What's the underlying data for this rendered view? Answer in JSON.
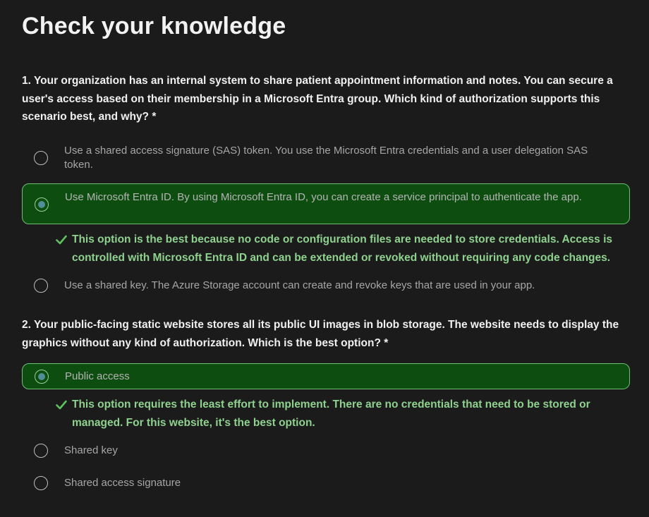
{
  "page": {
    "title": "Check your knowledge"
  },
  "questions": [
    {
      "text": "1. Your organization has an internal system to share patient appointment information and notes. You can secure a user's access based on their membership in a Microsoft Entra group. Which kind of authorization supports this scenario best, and why?",
      "required_marker": "*",
      "options": [
        {
          "label": "Use a shared access signature (SAS) token. You use the Microsoft Entra credentials and a user delegation SAS token.",
          "selected": false
        },
        {
          "label": "Use Microsoft Entra ID. By using Microsoft Entra ID, you can create a service principal to authenticate the app.",
          "selected": true
        },
        {
          "label": "Use a shared key. The Azure Storage account can create and revoke keys that are used in your app.",
          "selected": false
        }
      ],
      "feedback": "This option is the best because no code or configuration files are needed to store credentials. Access is controlled with Microsoft Entra ID and can be extended or revoked without requiring any code changes."
    },
    {
      "text": "2. Your public-facing static website stores all its public UI images in blob storage. The website needs to display the graphics without any kind of authorization. Which is the best option?",
      "required_marker": "*",
      "options": [
        {
          "label": "Public access",
          "selected": true
        },
        {
          "label": "Shared key",
          "selected": false
        },
        {
          "label": "Shared access signature",
          "selected": false
        }
      ],
      "feedback": "This option requires the least effort to implement. There are no credentials that need to be stored or managed. For this website, it's the best option."
    }
  ],
  "colors": {
    "background": "#1b1b1b",
    "selected_fill": "#0d4d10",
    "selected_border": "#6fbf73",
    "feedback_text": "#8fd18f"
  },
  "icons": {
    "radio": "radio-button-icon",
    "check": "checkmark-icon"
  }
}
